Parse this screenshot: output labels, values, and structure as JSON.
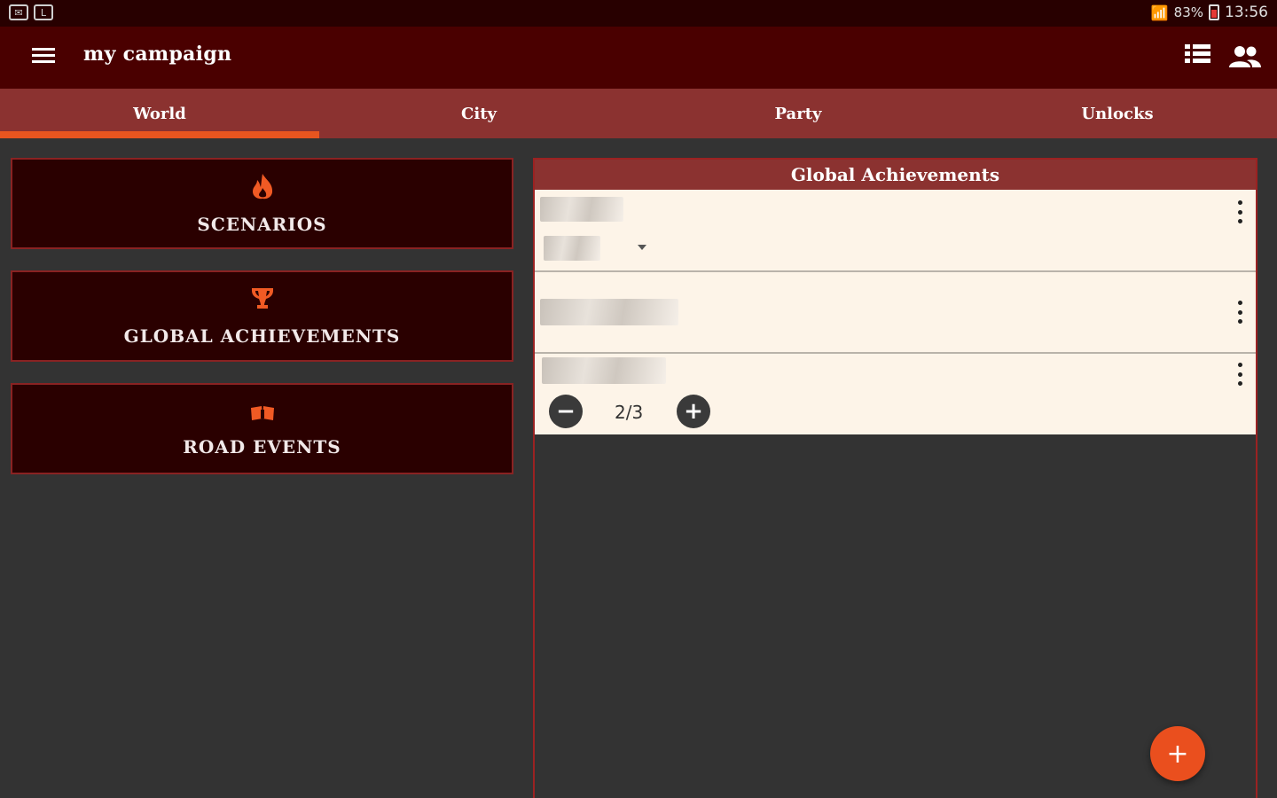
{
  "status_bar": {
    "battery": "83%",
    "time": "13:56"
  },
  "app_bar": {
    "title": "my campaign"
  },
  "tabs": [
    {
      "label": "World",
      "active": true
    },
    {
      "label": "City",
      "active": false
    },
    {
      "label": "Party",
      "active": false
    },
    {
      "label": "Unlocks",
      "active": false
    }
  ],
  "nav_cards": [
    {
      "label": "Scenarios",
      "icon": "flame-icon"
    },
    {
      "label": "Global Achievements",
      "icon": "trophy-icon"
    },
    {
      "label": "Road Events",
      "icon": "cards-icon"
    }
  ],
  "panel": {
    "title": "Global Achievements",
    "counter": "2/3"
  },
  "colors": {
    "accent": "#ea4f1e",
    "app_bar": "#4a0000",
    "tab_bar": "#8b3230",
    "card_bg": "#2a0000",
    "list_bg": "#fdf4e8"
  }
}
